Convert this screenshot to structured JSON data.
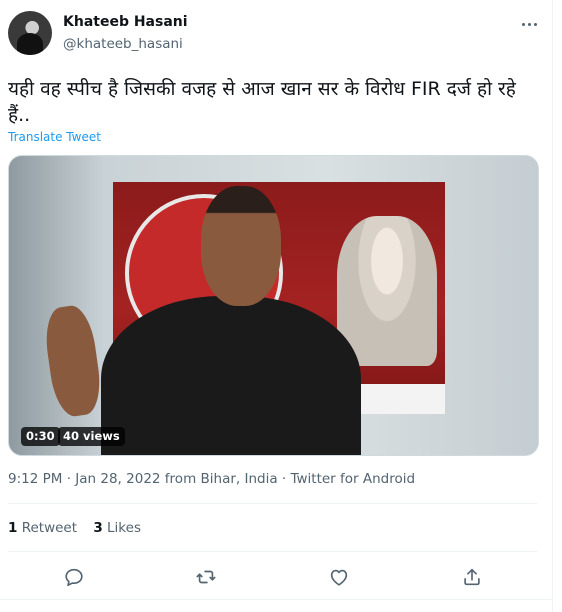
{
  "author": {
    "name": "Khateeb Hasani",
    "handle": "@khateeb_hasani"
  },
  "tweet": {
    "text": "यही वह स्पीच है जिसकी वजह से आज खान सर के विरोध FIR दर्ज हो रहे हैं..",
    "translate_label": "Translate Tweet"
  },
  "media": {
    "duration": "0:30",
    "views": "40 views"
  },
  "meta": {
    "time": "9:12 PM",
    "date": "Jan 28, 2022",
    "location": "from Bihar, India",
    "source": "Twitter for Android",
    "separator": " · "
  },
  "stats": {
    "retweets": "1",
    "retweets_label": "Retweet",
    "likes": "3",
    "likes_label": "Likes"
  },
  "icons": [
    "more-icon",
    "reply-icon",
    "retweet-icon",
    "like-icon",
    "share-icon"
  ],
  "colors": {
    "link": "#1d9bf0",
    "secondary": "#536471",
    "primary": "#0f1419"
  }
}
